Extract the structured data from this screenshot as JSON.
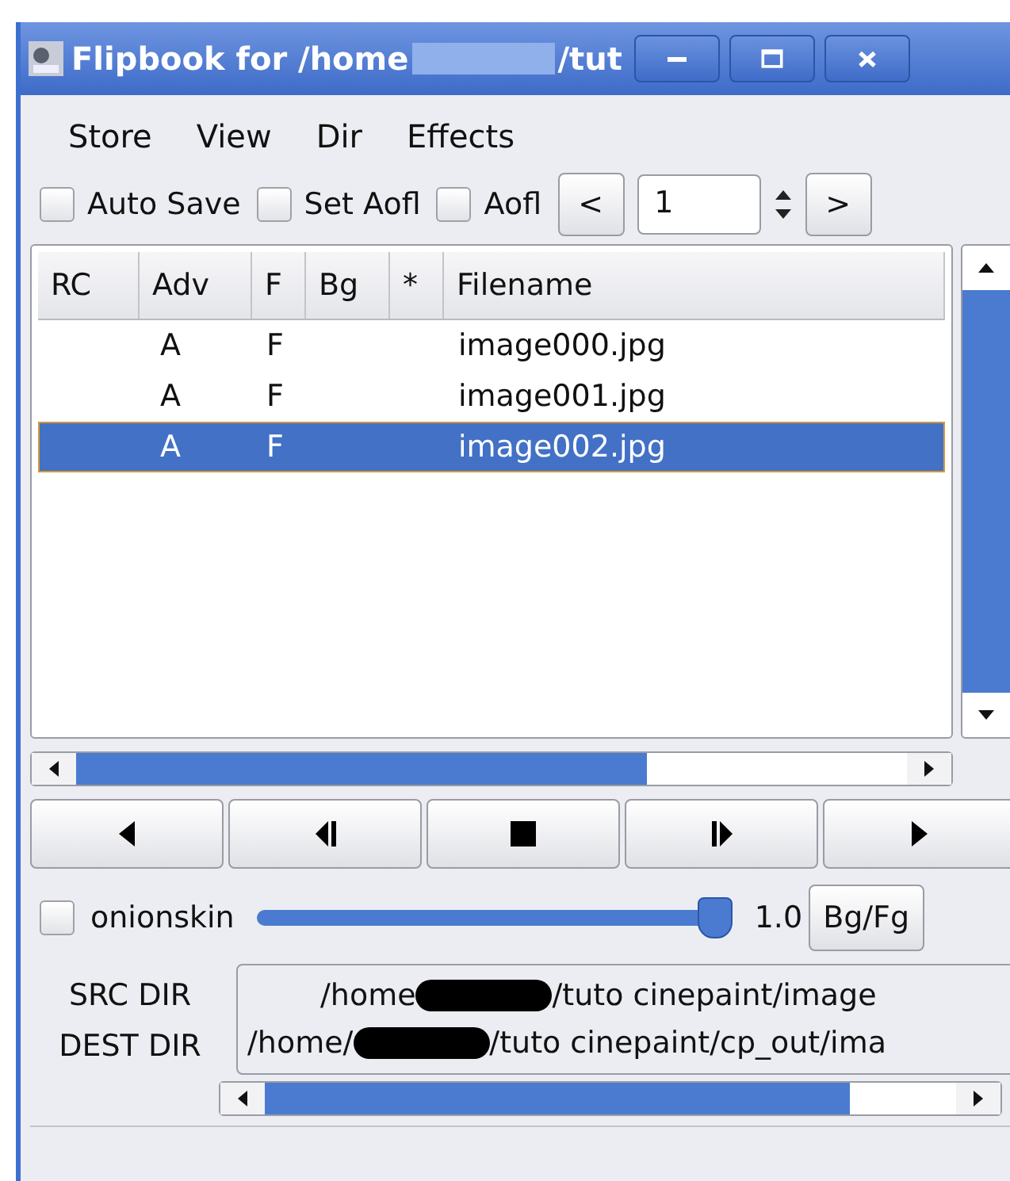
{
  "window": {
    "title_start": "Flipbook for /home",
    "title_end": "/tut"
  },
  "menu": [
    "Store",
    "View",
    "Dir",
    "Effects"
  ],
  "toolbar": {
    "checks": [
      {
        "label": "Auto Save",
        "checked": false
      },
      {
        "label": "Set Aofl",
        "checked": false
      },
      {
        "label": "Aofl",
        "checked": false
      }
    ],
    "prev": "<",
    "frame": "1",
    "next": ">"
  },
  "table": {
    "columns": [
      "RC",
      "Adv",
      "F",
      "Bg",
      "*",
      "Filename"
    ],
    "rows": [
      {
        "adv": "A",
        "f": "F",
        "filename": "image000.jpg",
        "selected": false
      },
      {
        "adv": "A",
        "f": "F",
        "filename": "image001.jpg",
        "selected": false
      },
      {
        "adv": "A",
        "f": "F",
        "filename": "image002.jpg",
        "selected": true
      }
    ]
  },
  "player": [
    {
      "kind": "back"
    },
    {
      "kind": "step_back"
    },
    {
      "kind": "stop"
    },
    {
      "kind": "step_forward"
    },
    {
      "kind": "play"
    }
  ],
  "onionskin": {
    "label": "onionskin",
    "checked": false,
    "level": 1,
    "reading": "1.0",
    "button": "Bg/Fg"
  },
  "dirs": [
    {
      "label": "SRC DIR",
      "start": "/home",
      "end": "/tuto cinepaint/image"
    },
    {
      "label": "DEST DIR",
      "start": "/home/",
      "end": "/tuto cinepaint/cp_out/ima"
    }
  ]
}
